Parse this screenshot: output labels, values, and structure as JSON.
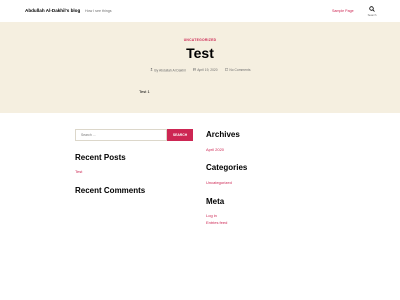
{
  "header": {
    "site_title": "Abdullah Al-Dakhil's blog",
    "site_description": "How I see things",
    "nav_link": "Sample Page",
    "search_label": "Search"
  },
  "post": {
    "category": "UNCATEGORIZED",
    "title": "Test",
    "author": "By Abdullah Al Dakhil",
    "date": "April 19, 2020",
    "comments": "No Comments",
    "excerpt": "Test 1"
  },
  "widgets": {
    "search_placeholder": "Search ...",
    "search_button": "SEARCH",
    "recent_posts_title": "Recent Posts",
    "recent_posts": [
      "Test"
    ],
    "recent_comments_title": "Recent Comments",
    "archives_title": "Archives",
    "archives": [
      "April 2020"
    ],
    "categories_title": "Categories",
    "categories": [
      "Uncategorized"
    ],
    "meta_title": "Meta",
    "meta_links": [
      "Log in",
      "Entries feed"
    ]
  },
  "colors": {
    "accent": "#cd2653",
    "hero_bg": "#f5efe0"
  },
  "icons": [
    "search-icon",
    "user-icon",
    "calendar-icon",
    "comment-icon"
  ]
}
